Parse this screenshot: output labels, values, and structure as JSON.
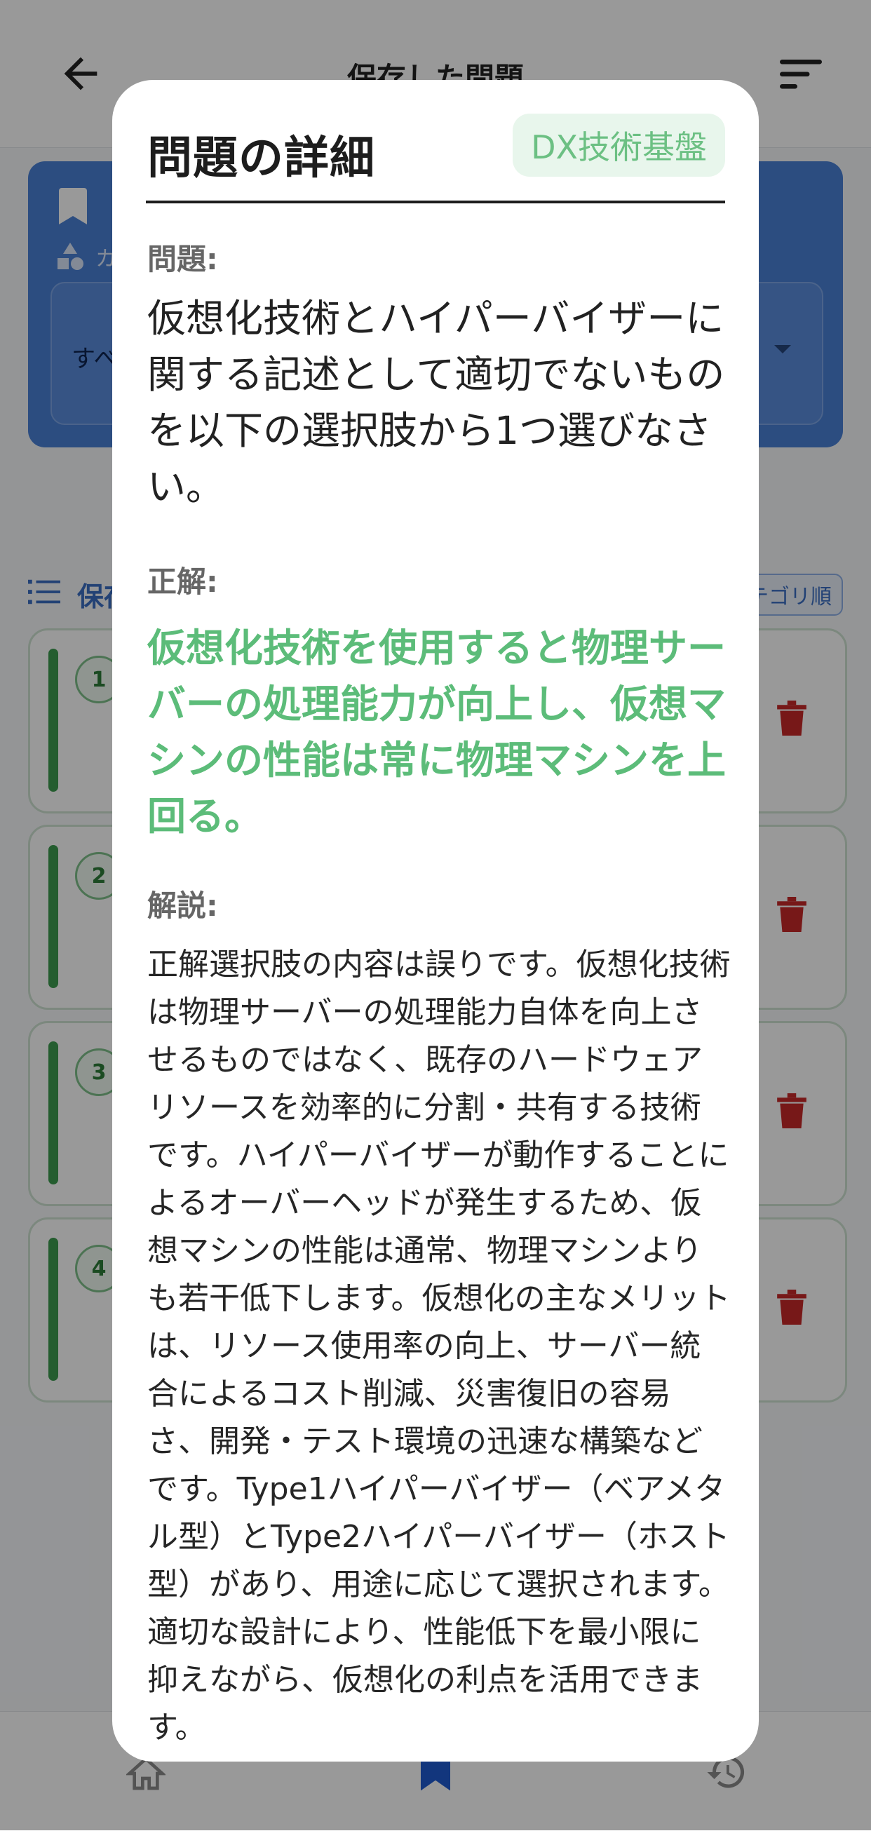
{
  "background": {
    "header": {
      "title": "保存した問題"
    },
    "filter": {
      "category_label": "カテゴリ",
      "selected_value": "すべて"
    },
    "list": {
      "title": "保存した問題",
      "sort_label": "カテゴリ順"
    },
    "cards": [
      {
        "number": "1"
      },
      {
        "number": "2"
      },
      {
        "number": "3"
      },
      {
        "number": "4"
      }
    ],
    "colors": {
      "accent_blue": "#4a80d6",
      "card_green": "#3c9b4f",
      "delete_red": "#c62828"
    }
  },
  "modal": {
    "title": "問題の詳細",
    "category": "DX技術基盤",
    "question_label": "問題:",
    "question": "仮想化技術とハイパーバイザーに関する記述として適切でないものを以下の選択肢から1つ選びなさい。",
    "answer_label": "正解:",
    "answer": "仮想化技術を使用すると物理サーバーの処理能力が向上し、仮想マシンの性能は常に物理マシンを上回る。",
    "explanation_label": "解説:",
    "explanation": "正解選択肢の内容は誤りです。仮想化技術は物理サーバーの処理能力自体を向上させるものではなく、既存のハードウェアリソースを効率的に分割・共有する技術です。ハイパーバイザーが動作することによるオーバーヘッドが発生するため、仮想マシンの性能は通常、物理マシンよりも若干低下します。仮想化の主なメリットは、リソース使用率の向上、サーバー統合によるコスト削減、災害復旧の容易さ、開発・テスト環境の迅速な構築などです。Type1ハイパーバイザー（ベアメタル型）とType2ハイパーバイザー（ホスト型）があり、用途に応じて選択されます。適切な設計により、性能低下を最小限に抑えながら、仮想化の利点を活用できます。",
    "colors": {
      "answer_green": "#5cbc79",
      "chip_bg": "#e8f6ec"
    }
  }
}
